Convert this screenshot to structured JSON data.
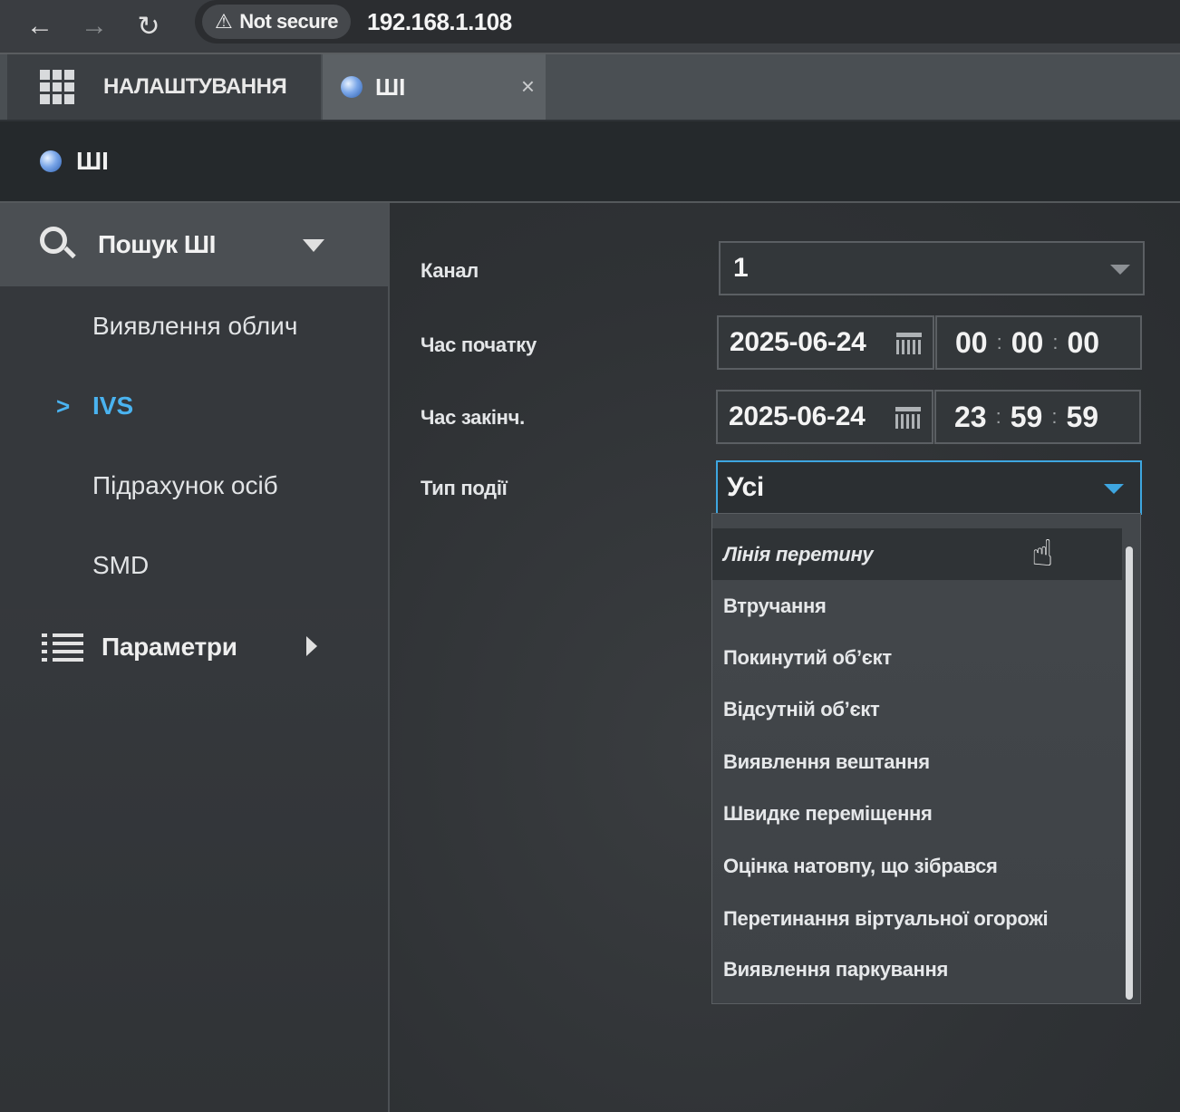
{
  "browser": {
    "security_label": "Not secure",
    "url": "192.168.1.108",
    "back_icon": "back-arrow-icon",
    "forward_icon": "forward-arrow-icon",
    "reload_icon": "reload-icon"
  },
  "tabs": [
    {
      "label": "НАЛАШТУВАННЯ",
      "icon": "grid-icon"
    },
    {
      "label": "ШІ",
      "icon": "globe-icon",
      "close": "×"
    }
  ],
  "header": {
    "title": "ШІ"
  },
  "sidebar": {
    "section_title": "Пошук ШІ",
    "items": [
      {
        "label": "Виявлення облич",
        "active": false
      },
      {
        "label": "IVS",
        "active": true
      },
      {
        "label": "Підрахунок осіб",
        "active": false
      },
      {
        "label": "SMD",
        "active": false
      }
    ],
    "active_marker": ">",
    "params_label": "Параметри"
  },
  "form": {
    "channel_label": "Канал",
    "channel_value": "1",
    "start_label": "Час початку",
    "start_date": "2025-06-24",
    "start_time": {
      "h": "00",
      "m": "00",
      "s": "00"
    },
    "end_label": "Час закінч.",
    "end_date": "2025-06-24",
    "end_time": {
      "h": "23",
      "m": "59",
      "s": "59"
    },
    "event_type_label": "Тип події",
    "event_type_value": "Усі",
    "time_separator": ":"
  },
  "dropdown": {
    "options": [
      "Лінія перетину",
      "Втручання",
      "Покинутий об’єкт",
      "Відсутній об’єкт",
      "Виявлення вештання",
      "Швидке переміщення",
      "Оцінка натовпу, що зібрався",
      "Перетинання віртуальної огорожі",
      "Виявлення паркування"
    ],
    "hovered_index": 0
  },
  "colors": {
    "accent": "#4ab3f0",
    "active_border": "#3ea6e0"
  }
}
